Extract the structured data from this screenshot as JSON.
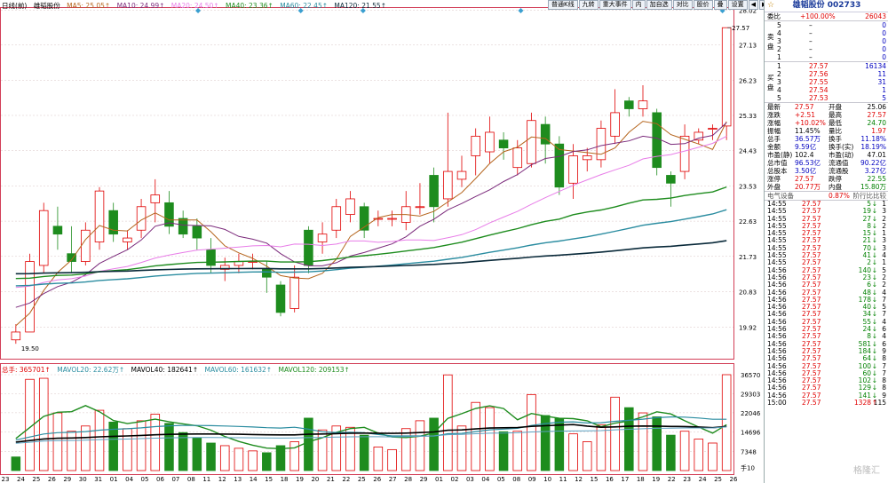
{
  "colors": {
    "up": "#e00000",
    "down": "#1e8c1e",
    "ma5": "#b5651d",
    "ma10": "#7b2a7b",
    "ma20": "#e87de8",
    "ma40": "#1e8c1e",
    "ma60": "#2a8ca0",
    "ma120": "#0a2a3a"
  },
  "ma_legend": {
    "period": "日线(前)",
    "name": "雄韬股份",
    "ma5": "MA5: 25.05↑",
    "ma10": "MA10: 24.99↑",
    "ma20": "MA20: 24.50↑",
    "ma40": "MA40: 23.36↑",
    "ma60": "MA60: 22.45↑",
    "ma120": "MA120: 21.55↑"
  },
  "vol_legend": {
    "vol": "总手: 365701↑",
    "mavol20": "MAVOL20: 22.62万↑",
    "mavol40": "MAVOL40: 182641↑",
    "mavol60": "MAVOL60: 161632↑",
    "mavol120": "MAVOL120: 209153↑"
  },
  "toolbar": [
    "普通K线",
    "九转",
    "重大事件",
    "内",
    "加自选",
    "对比",
    "股价",
    "叠",
    "设置",
    "◀",
    "▶"
  ],
  "price_axis": [
    "28.02",
    "27.13",
    "26.23",
    "25.33",
    "24.43",
    "23.53",
    "22.63",
    "21.73",
    "20.83",
    "19.92"
  ],
  "volume_axis": [
    "36570",
    "29303",
    "22046",
    "14696",
    "7348",
    "手10"
  ],
  "date_axis": [
    "23",
    "24",
    "25",
    "26",
    "29",
    "30",
    "31",
    "01",
    "04",
    "05",
    "06",
    "07",
    "08",
    "11",
    "12",
    "13",
    "14",
    "15",
    "18",
    "19",
    "20",
    "21",
    "22",
    "25",
    "26",
    "27",
    "28",
    "29",
    "01",
    "02",
    "03",
    "04",
    "05",
    "08",
    "09",
    "10",
    "11",
    "12",
    "15",
    "16",
    "17",
    "18",
    "19",
    "22",
    "23",
    "24",
    "25",
    "26"
  ],
  "chart_labels": {
    "high_label": "27.57",
    "low_label": "19.50"
  },
  "chart_data": {
    "type": "candlestick",
    "candles": [
      {
        "o": 19.6,
        "c": 19.8,
        "h": 20.0,
        "l": 19.5
      },
      {
        "o": 19.8,
        "c": 21.6,
        "h": 21.8,
        "l": 19.8
      },
      {
        "o": 21.5,
        "c": 22.9,
        "h": 23.1,
        "l": 21.3
      },
      {
        "o": 22.5,
        "c": 22.3,
        "h": 23.0,
        "l": 21.9
      },
      {
        "o": 21.8,
        "c": 21.6,
        "h": 22.5,
        "l": 21.3
      },
      {
        "o": 21.6,
        "c": 22.4,
        "h": 22.6,
        "l": 21.5
      },
      {
        "o": 22.1,
        "c": 23.4,
        "h": 23.5,
        "l": 21.9
      },
      {
        "o": 22.9,
        "c": 22.3,
        "h": 23.1,
        "l": 22.1
      },
      {
        "o": 22.1,
        "c": 22.2,
        "h": 22.4,
        "l": 21.9
      },
      {
        "o": 22.4,
        "c": 23.0,
        "h": 23.2,
        "l": 22.2
      },
      {
        "o": 23.1,
        "c": 23.3,
        "h": 23.7,
        "l": 22.6
      },
      {
        "o": 23.1,
        "c": 22.5,
        "h": 23.4,
        "l": 22.3
      },
      {
        "o": 22.7,
        "c": 22.3,
        "h": 22.9,
        "l": 22.2
      },
      {
        "o": 22.5,
        "c": 22.2,
        "h": 22.7,
        "l": 21.9
      },
      {
        "o": 21.9,
        "c": 21.5,
        "h": 22.2,
        "l": 21.3
      },
      {
        "o": 21.4,
        "c": 21.5,
        "h": 21.7,
        "l": 21.1
      },
      {
        "o": 21.5,
        "c": 21.6,
        "h": 21.8,
        "l": 21.3
      },
      {
        "o": 21.6,
        "c": 21.6,
        "h": 21.8,
        "l": 21.4
      },
      {
        "o": 21.4,
        "c": 21.2,
        "h": 21.6,
        "l": 20.8
      },
      {
        "o": 21.0,
        "c": 20.3,
        "h": 21.1,
        "l": 20.2
      },
      {
        "o": 20.4,
        "c": 21.2,
        "h": 21.5,
        "l": 20.3
      },
      {
        "o": 22.4,
        "c": 21.5,
        "h": 22.5,
        "l": 21.3
      },
      {
        "o": 22.1,
        "c": 22.3,
        "h": 22.6,
        "l": 21.8
      },
      {
        "o": 22.4,
        "c": 23.0,
        "h": 23.2,
        "l": 22.2
      },
      {
        "o": 22.8,
        "c": 23.2,
        "h": 23.4,
        "l": 22.6
      },
      {
        "o": 23.0,
        "c": 22.4,
        "h": 23.1,
        "l": 22.2
      },
      {
        "o": 22.7,
        "c": 22.7,
        "h": 22.9,
        "l": 22.5
      },
      {
        "o": 22.7,
        "c": 22.7,
        "h": 22.9,
        "l": 22.5
      },
      {
        "o": 22.6,
        "c": 23.0,
        "h": 23.4,
        "l": 22.4
      },
      {
        "o": 23.0,
        "c": 23.0,
        "h": 23.6,
        "l": 22.8
      },
      {
        "o": 23.8,
        "c": 23.0,
        "h": 24.0,
        "l": 22.6
      },
      {
        "o": 23.2,
        "c": 23.9,
        "h": 25.4,
        "l": 23.0
      },
      {
        "o": 23.7,
        "c": 23.9,
        "h": 24.3,
        "l": 23.5
      },
      {
        "o": 24.3,
        "c": 24.8,
        "h": 25.0,
        "l": 23.8
      },
      {
        "o": 24.4,
        "c": 24.9,
        "h": 25.3,
        "l": 24.1
      },
      {
        "o": 24.7,
        "c": 24.5,
        "h": 24.9,
        "l": 24.2
      },
      {
        "o": 24.0,
        "c": 24.5,
        "h": 24.7,
        "l": 23.8
      },
      {
        "o": 24.1,
        "c": 25.2,
        "h": 25.4,
        "l": 24.0
      },
      {
        "o": 25.1,
        "c": 24.6,
        "h": 25.3,
        "l": 24.1
      },
      {
        "o": 24.6,
        "c": 23.5,
        "h": 24.8,
        "l": 23.3
      },
      {
        "o": 23.6,
        "c": 24.3,
        "h": 24.6,
        "l": 23.2
      },
      {
        "o": 24.2,
        "c": 24.3,
        "h": 24.5,
        "l": 23.9
      },
      {
        "o": 24.2,
        "c": 25.0,
        "h": 25.2,
        "l": 24.0
      },
      {
        "o": 24.8,
        "c": 25.4,
        "h": 26.0,
        "l": 24.6
      },
      {
        "o": 25.7,
        "c": 25.5,
        "h": 25.8,
        "l": 25.3
      },
      {
        "o": 25.5,
        "c": 25.7,
        "h": 26.1,
        "l": 25.3
      },
      {
        "o": 25.4,
        "c": 24.0,
        "h": 25.5,
        "l": 23.8
      },
      {
        "o": 23.8,
        "c": 23.6,
        "h": 23.9,
        "l": 23.0
      },
      {
        "o": 23.9,
        "c": 24.8,
        "h": 25.1,
        "l": 23.7
      },
      {
        "o": 24.7,
        "c": 24.9,
        "h": 25.0,
        "l": 24.6
      },
      {
        "o": 25.0,
        "c": 25.0,
        "h": 25.1,
        "l": 24.7
      },
      {
        "o": 25.06,
        "c": 27.57,
        "h": 27.57,
        "l": 24.7
      }
    ],
    "volumes": [
      {
        "v": 5200,
        "up": false
      },
      {
        "v": 34800,
        "up": true
      },
      {
        "v": 35200,
        "up": true
      },
      {
        "v": 22000,
        "up": true
      },
      {
        "v": 15000,
        "up": true
      },
      {
        "v": 17000,
        "up": true
      },
      {
        "v": 23000,
        "up": true
      },
      {
        "v": 18500,
        "up": false
      },
      {
        "v": 16000,
        "up": true
      },
      {
        "v": 19000,
        "up": true
      },
      {
        "v": 21500,
        "up": true
      },
      {
        "v": 18000,
        "up": false
      },
      {
        "v": 14500,
        "up": false
      },
      {
        "v": 12500,
        "up": false
      },
      {
        "v": 10500,
        "up": false
      },
      {
        "v": 9500,
        "up": true
      },
      {
        "v": 8500,
        "up": true
      },
      {
        "v": 7500,
        "up": true
      },
      {
        "v": 6800,
        "up": false
      },
      {
        "v": 9500,
        "up": false
      },
      {
        "v": 11000,
        "up": true
      },
      {
        "v": 20000,
        "up": false
      },
      {
        "v": 15500,
        "up": true
      },
      {
        "v": 17000,
        "up": true
      },
      {
        "v": 16500,
        "up": true
      },
      {
        "v": 13500,
        "up": false
      },
      {
        "v": 9000,
        "up": true
      },
      {
        "v": 8000,
        "up": true
      },
      {
        "v": 16000,
        "up": true
      },
      {
        "v": 19000,
        "up": true
      },
      {
        "v": 20000,
        "up": false
      },
      {
        "v": 36500,
        "up": true
      },
      {
        "v": 17000,
        "up": true
      },
      {
        "v": 26000,
        "up": true
      },
      {
        "v": 24000,
        "up": true
      },
      {
        "v": 14800,
        "up": false
      },
      {
        "v": 15000,
        "up": true
      },
      {
        "v": 29000,
        "up": true
      },
      {
        "v": 21000,
        "up": false
      },
      {
        "v": 20000,
        "up": false
      },
      {
        "v": 14000,
        "up": true
      },
      {
        "v": 11000,
        "up": true
      },
      {
        "v": 17500,
        "up": true
      },
      {
        "v": 28000,
        "up": true
      },
      {
        "v": 24000,
        "up": false
      },
      {
        "v": 22000,
        "up": true
      },
      {
        "v": 20500,
        "up": false
      },
      {
        "v": 13500,
        "up": false
      },
      {
        "v": 15000,
        "up": true
      },
      {
        "v": 12000,
        "up": true
      },
      {
        "v": 10500,
        "up": true
      },
      {
        "v": 36570,
        "up": true
      }
    ],
    "price_range": [
      19.5,
      28.02
    ],
    "volume_range": [
      0,
      36570
    ]
  },
  "side": {
    "title": "雄韬股份 002733",
    "weibi_label": "委比",
    "weibi_value": "+100.00%",
    "weibi_diff": "26043",
    "sell_label": "卖盘",
    "sell": [
      {
        "lvl": "5",
        "price": "–",
        "vol": "0"
      },
      {
        "lvl": "4",
        "price": "–",
        "vol": "0"
      },
      {
        "lvl": "3",
        "price": "–",
        "vol": "0"
      },
      {
        "lvl": "2",
        "price": "–",
        "vol": "0"
      },
      {
        "lvl": "1",
        "price": "–",
        "vol": "0"
      }
    ],
    "buy_label": "买盘",
    "buy": [
      {
        "lvl": "1",
        "price": "27.57",
        "vol": "16134"
      },
      {
        "lvl": "2",
        "price": "27.56",
        "vol": "11"
      },
      {
        "lvl": "3",
        "price": "27.55",
        "vol": "31"
      },
      {
        "lvl": "4",
        "price": "27.54",
        "vol": "1"
      },
      {
        "lvl": "5",
        "price": "27.53",
        "vol": "5"
      }
    ],
    "quote": [
      {
        "l1": "最新",
        "v1": "27.57",
        "c1": "red",
        "l2": "开盘",
        "v2": "25.06",
        "c2": "black"
      },
      {
        "l1": "涨跌",
        "v1": "+2.51",
        "c1": "red",
        "l2": "最高",
        "v2": "27.57",
        "c2": "red"
      },
      {
        "l1": "涨幅",
        "v1": "+10.02%",
        "c1": "red",
        "l2": "最低",
        "v2": "24.70",
        "c2": "green"
      },
      {
        "l1": "振幅",
        "v1": "11.45%",
        "c1": "black",
        "l2": "量比",
        "v2": "1.97",
        "c2": "red"
      },
      {
        "l1": "总手",
        "v1": "36.57万",
        "c1": "blue",
        "l2": "换手",
        "v2": "11.18%",
        "c2": "blue"
      },
      {
        "l1": "金额",
        "v1": "9.59亿",
        "c1": "blue",
        "l2": "换手(实)",
        "v2": "18.19%",
        "c2": "blue"
      },
      {
        "l1": "市盈(静)",
        "v1": "102.4",
        "c1": "black",
        "l2": "市盈(动)",
        "v2": "47.01",
        "c2": "black"
      },
      {
        "l1": "总市值",
        "v1": "96.53亿",
        "c1": "blue",
        "l2": "流通值",
        "v2": "90.22亿",
        "c2": "blue"
      },
      {
        "l1": "总股本",
        "v1": "3.50亿",
        "c1": "blue",
        "l2": "流通股",
        "v2": "3.27亿",
        "c2": "blue"
      },
      {
        "l1": "涨停",
        "v1": "27.57",
        "c1": "red",
        "l2": "跌停",
        "v2": "22.55",
        "c2": "green"
      },
      {
        "l1": "外盘",
        "v1": "20.77万",
        "c1": "red",
        "l2": "内盘",
        "v2": "15.80万",
        "c2": "green"
      }
    ],
    "sector_label": "电气设备",
    "sector_value": "0.87%",
    "sector_link": "阶行比比较",
    "ticks": [
      {
        "t": "14:55",
        "p": "27.57",
        "v": "5",
        "d": "dn",
        "n": "1"
      },
      {
        "t": "14:55",
        "p": "27.57",
        "v": "19",
        "d": "dn",
        "n": "3"
      },
      {
        "t": "14:55",
        "p": "27.57",
        "v": "27",
        "d": "dn",
        "n": "2"
      },
      {
        "t": "14:55",
        "p": "27.57",
        "v": "8",
        "d": "dn",
        "n": "2"
      },
      {
        "t": "14:55",
        "p": "27.57",
        "v": "15",
        "d": "dn",
        "n": "1"
      },
      {
        "t": "14:55",
        "p": "27.57",
        "v": "21",
        "d": "dn",
        "n": "3"
      },
      {
        "t": "14:55",
        "p": "27.57",
        "v": "70",
        "d": "dn",
        "n": "3"
      },
      {
        "t": "14:55",
        "p": "27.57",
        "v": "41",
        "d": "dn",
        "n": "4"
      },
      {
        "t": "14:55",
        "p": "27.57",
        "v": "2",
        "d": "dn",
        "n": "1"
      },
      {
        "t": "14:56",
        "p": "27.57",
        "v": "140",
        "d": "dn",
        "n": "5"
      },
      {
        "t": "14:56",
        "p": "27.57",
        "v": "23",
        "d": "dn",
        "n": "2"
      },
      {
        "t": "14:56",
        "p": "27.57",
        "v": "6",
        "d": "dn",
        "n": "2"
      },
      {
        "t": "14:56",
        "p": "27.57",
        "v": "48",
        "d": "dn",
        "n": "4"
      },
      {
        "t": "14:56",
        "p": "27.57",
        "v": "178",
        "d": "dn",
        "n": "7"
      },
      {
        "t": "14:56",
        "p": "27.57",
        "v": "40",
        "d": "dn",
        "n": "5"
      },
      {
        "t": "14:56",
        "p": "27.57",
        "v": "34",
        "d": "dn",
        "n": "7"
      },
      {
        "t": "14:56",
        "p": "27.57",
        "v": "55",
        "d": "dn",
        "n": "4"
      },
      {
        "t": "14:56",
        "p": "27.57",
        "v": "24",
        "d": "dn",
        "n": "6"
      },
      {
        "t": "14:56",
        "p": "27.57",
        "v": "8",
        "d": "dn",
        "n": "4"
      },
      {
        "t": "14:56",
        "p": "27.57",
        "v": "581",
        "d": "dn",
        "n": "6"
      },
      {
        "t": "14:56",
        "p": "27.57",
        "v": "184",
        "d": "dn",
        "n": "9"
      },
      {
        "t": "14:56",
        "p": "27.57",
        "v": "64",
        "d": "dn",
        "n": "8"
      },
      {
        "t": "14:56",
        "p": "27.57",
        "v": "100",
        "d": "dn",
        "n": "7"
      },
      {
        "t": "14:56",
        "p": "27.57",
        "v": "60",
        "d": "dn",
        "n": "7"
      },
      {
        "t": "14:56",
        "p": "27.57",
        "v": "102",
        "d": "dn",
        "n": "8"
      },
      {
        "t": "14:56",
        "p": "27.57",
        "v": "129",
        "d": "dn",
        "n": "8"
      },
      {
        "t": "14:56",
        "p": "27.57",
        "v": "141",
        "d": "dn",
        "n": "9"
      },
      {
        "t": "15:00",
        "p": "27.57",
        "v": "1328",
        "d": "up",
        "n": "115"
      }
    ],
    "watermark": "格隆汇"
  }
}
